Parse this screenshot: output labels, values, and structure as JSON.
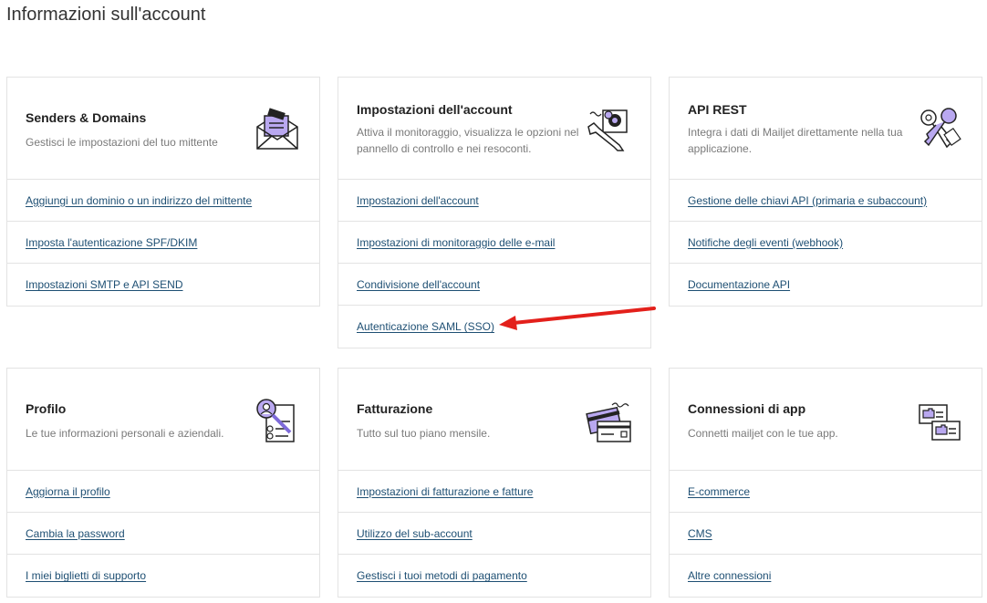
{
  "page": {
    "title": "Informazioni sull'account"
  },
  "cards": {
    "senders": {
      "title": "Senders & Domains",
      "desc": "Gestisci le impostazioni del tuo mittente",
      "icon": "envelope-document-icon",
      "links": [
        "Aggiungi un dominio o un indirizzo del mittente",
        "Imposta l'autenticazione SPF/DKIM",
        "Impostazioni SMTP e API SEND"
      ]
    },
    "account": {
      "title": "Impostazioni dell'account",
      "desc": "Attiva il monitoraggio, visualizza le opzioni nel pannello di controllo e nei resoconti.",
      "icon": "wrench-gear-icon",
      "links": [
        "Impostazioni dell'account",
        "Impostazioni di monitoraggio delle e-mail",
        "Condivisione dell'account",
        "Autenticazione SAML (SSO)"
      ]
    },
    "api": {
      "title": "API REST",
      "desc": "Integra i dati di Mailjet direttamente nella tua applicazione.",
      "icon": "keys-icon",
      "links": [
        "Gestione delle chiavi API (primaria e subaccount)",
        "Notifiche degli eventi (webhook)",
        "Documentazione API"
      ]
    },
    "profile": {
      "title": "Profilo",
      "desc": "Le tue informazioni personali e aziendali.",
      "icon": "profile-magnifier-icon",
      "links": [
        "Aggiorna il profilo",
        "Cambia la password",
        "I miei biglietti di supporto"
      ]
    },
    "billing": {
      "title": "Fatturazione",
      "desc": "Tutto sul tuo piano mensile.",
      "icon": "credit-card-icon",
      "links": [
        "Impostazioni di fatturazione e fatture",
        "Utilizzo del sub-account",
        "Gestisci i tuoi metodi di pagamento"
      ]
    },
    "apps": {
      "title": "Connessioni di app",
      "desc": "Connetti mailjet con le tue app.",
      "icon": "app-connection-icon",
      "links": [
        "E-commerce",
        "CMS",
        "Altre connessioni"
      ]
    }
  },
  "colors": {
    "accent": "#b9a8f0",
    "accent_dark": "#7e6bd9",
    "link": "#1e4f73",
    "arrow": "#e3201b"
  }
}
